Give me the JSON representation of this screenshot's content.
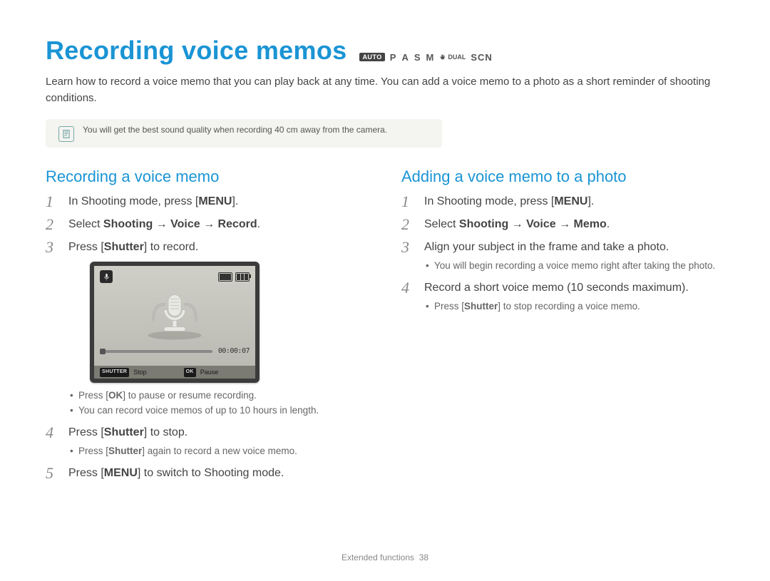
{
  "title": "Recording voice memos",
  "modes": {
    "auto": "AUTO",
    "p": "P",
    "a": "A",
    "s": "S",
    "m": "M",
    "dual": "DUAL",
    "scn": "SCN"
  },
  "intro": "Learn how to record a voice memo that you can play back at any time. You can add a voice memo to a photo as a short reminder of shooting conditions.",
  "tip": "You will get the best sound quality when recording 40 cm away from the camera.",
  "left": {
    "heading": "Recording a voice memo",
    "s1_a": "In Shooting mode, press [",
    "s1_b": "MENU",
    "s1_c": "].",
    "s2_a": "Select ",
    "s2_b": "Shooting",
    "s2_arrow": " → ",
    "s2_c": "Voice",
    "s2_d": "Record",
    "s2_e": ".",
    "s3_a": "Press [",
    "s3_b": "Shutter",
    "s3_c": "] to record.",
    "s3_sub1_a": "Press [",
    "s3_sub1_b": "OK",
    "s3_sub1_c": "] to pause or resume recording.",
    "s3_sub2": "You can record voice memos of up to 10 hours in length.",
    "s4_a": "Press [",
    "s4_b": "Shutter",
    "s4_c": "] to stop.",
    "s4_sub_a": "Press [",
    "s4_sub_b": "Shutter",
    "s4_sub_c": "] again to record a new voice memo.",
    "s5_a": "Press [",
    "s5_b": "MENU",
    "s5_c": "] to switch to Shooting mode."
  },
  "lcd": {
    "time": "00:00:07",
    "k1": "SHUTTER",
    "l1": "Stop",
    "k2": "OK",
    "l2": "Pause"
  },
  "right": {
    "heading": "Adding a voice memo to a photo",
    "s1_a": "In Shooting mode, press [",
    "s1_b": "MENU",
    "s1_c": "].",
    "s2_a": "Select ",
    "s2_b": "Shooting",
    "s2_arrow": " → ",
    "s2_c": "Voice",
    "s2_d": "Memo",
    "s2_e": ".",
    "s3": "Align your subject in the frame and take a photo.",
    "s3_sub": "You will begin recording a voice memo right after taking the photo.",
    "s4": "Record a short voice memo (10 seconds maximum).",
    "s4_sub_a": "Press [",
    "s4_sub_b": "Shutter",
    "s4_sub_c": "] to stop recording a voice memo."
  },
  "footer_a": "Extended functions",
  "footer_b": "38",
  "nums": {
    "n1": "1",
    "n2": "2",
    "n3": "3",
    "n4": "4",
    "n5": "5"
  }
}
